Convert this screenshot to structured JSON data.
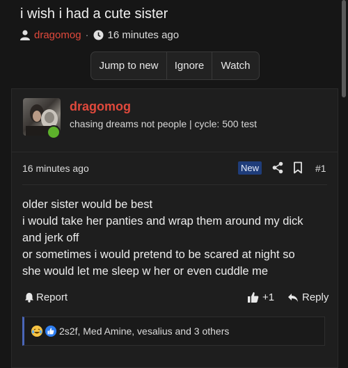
{
  "thread": {
    "title": "i wish i had a cute sister",
    "author": "dragomog",
    "separator": "·",
    "time": "16 minutes ago"
  },
  "actions": {
    "jump_to_new": "Jump to new",
    "ignore": "Ignore",
    "watch": "Watch"
  },
  "post": {
    "username": "dragomog",
    "user_title": "chasing dreams not people | cycle: 500 test",
    "time": "16 minutes ago",
    "badge": "New",
    "number": "#1",
    "body": [
      "older sister would be best",
      "i would take her panties and wrap them around my dick",
      "and jerk off",
      "or sometimes i would pretend to be scared at night so",
      "she would let me sleep w her or even cuddle me"
    ],
    "report_label": "Report",
    "like_label": "+1",
    "reply_label": "Reply",
    "reactions_text": "2s2f, Med Amine, vesalius and 3 others",
    "reaction_icons": [
      "crying-laughing-emoji-icon",
      "thumbs-up-emoji-icon"
    ]
  },
  "colors": {
    "accent": "#e0493c",
    "badge": "#1f3d7a",
    "online": "#5db12b"
  }
}
